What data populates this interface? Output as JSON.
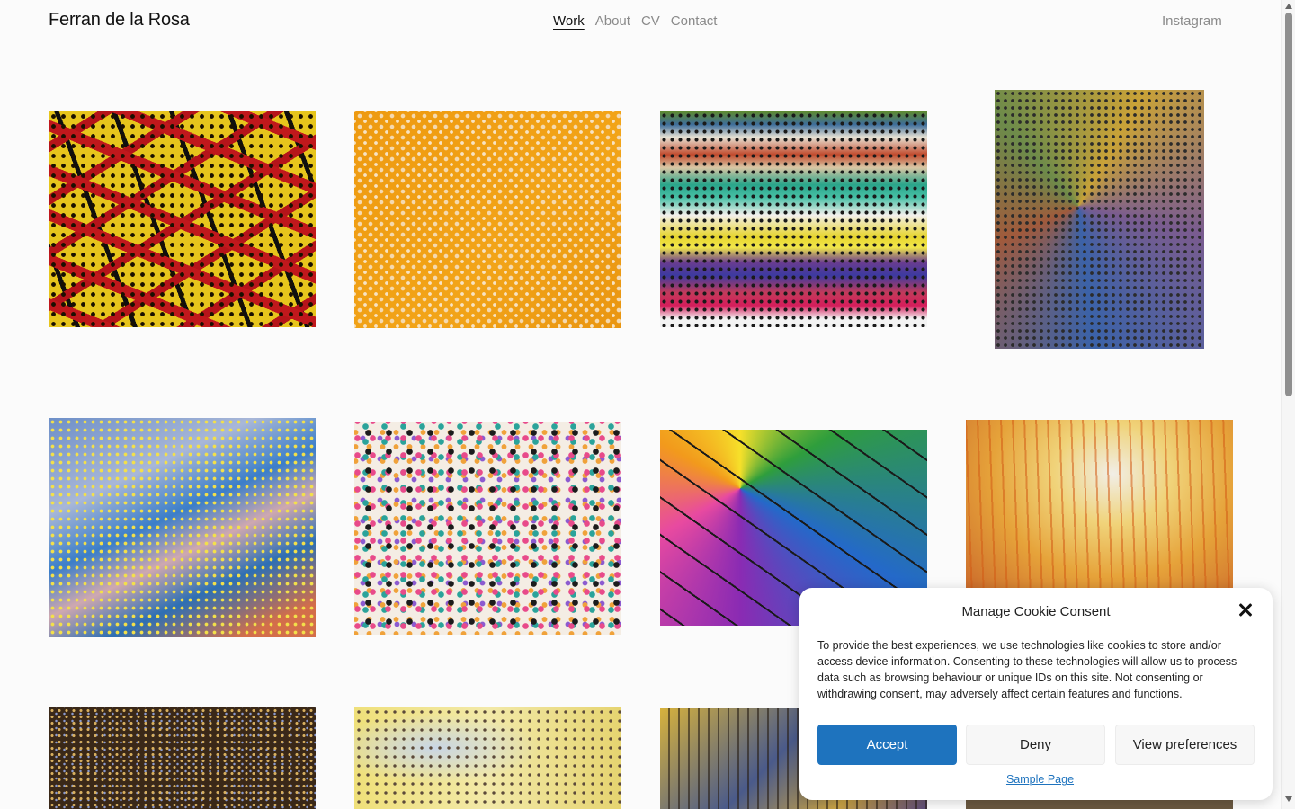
{
  "header": {
    "site_title": "Ferran de la Rosa",
    "nav": [
      {
        "label": "Work",
        "active": true
      },
      {
        "label": "About",
        "active": false
      },
      {
        "label": "CV",
        "active": false
      },
      {
        "label": "Contact",
        "active": false
      }
    ],
    "social_link": "Instagram"
  },
  "cookie_banner": {
    "title": "Manage Cookie Consent",
    "body": "To provide the best experiences, we use technologies like cookies to store and/or access device information. Consenting to these technologies will allow us to process data such as browsing behaviour or unique IDs on this site. Not consenting or withdrawing consent, may adversely affect certain features and functions.",
    "accept_label": "Accept",
    "deny_label": "Deny",
    "preferences_label": "View preferences",
    "link_label": "Sample Page",
    "close_icon": "close-icon"
  },
  "colors": {
    "accent": "#1e73be",
    "nav_inactive": "#8a8a8a",
    "background": "#fbfbfb"
  }
}
